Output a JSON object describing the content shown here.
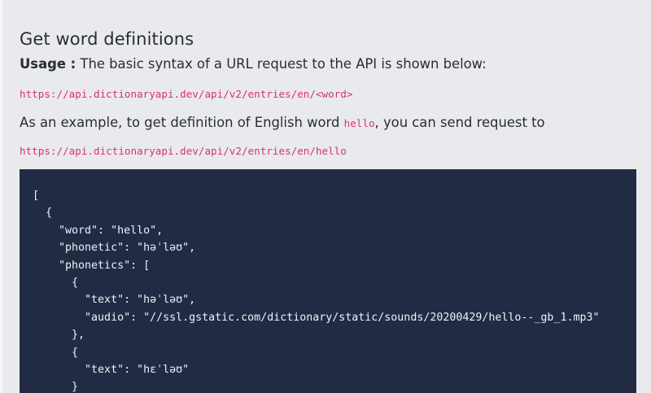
{
  "section": {
    "title": "Get word definitions",
    "usage_label": "Usage :",
    "usage_text": " The basic syntax of a URL request to the API is shown below:",
    "syntax_url": "https://api.dictionaryapi.dev/api/v2/entries/en/<word>",
    "example_text_before": "As an example, to get definition of English word ",
    "example_word": "hello",
    "example_text_after": ", you can send request to",
    "example_url": "https://api.dictionaryapi.dev/api/v2/entries/en/hello"
  },
  "code_block": {
    "lines": [
      "[",
      "  {",
      "    \"word\": \"hello\",",
      "    \"phonetic\": \"həˈləʊ\",",
      "    \"phonetics\": [",
      "      {",
      "        \"text\": \"həˈləʊ\",",
      "        \"audio\": \"//ssl.gstatic.com/dictionary/static/sounds/20200429/hello--_gb_1.mp3\"",
      "      },",
      "      {",
      "        \"text\": \"hɛˈləʊ\"",
      "      }"
    ]
  }
}
